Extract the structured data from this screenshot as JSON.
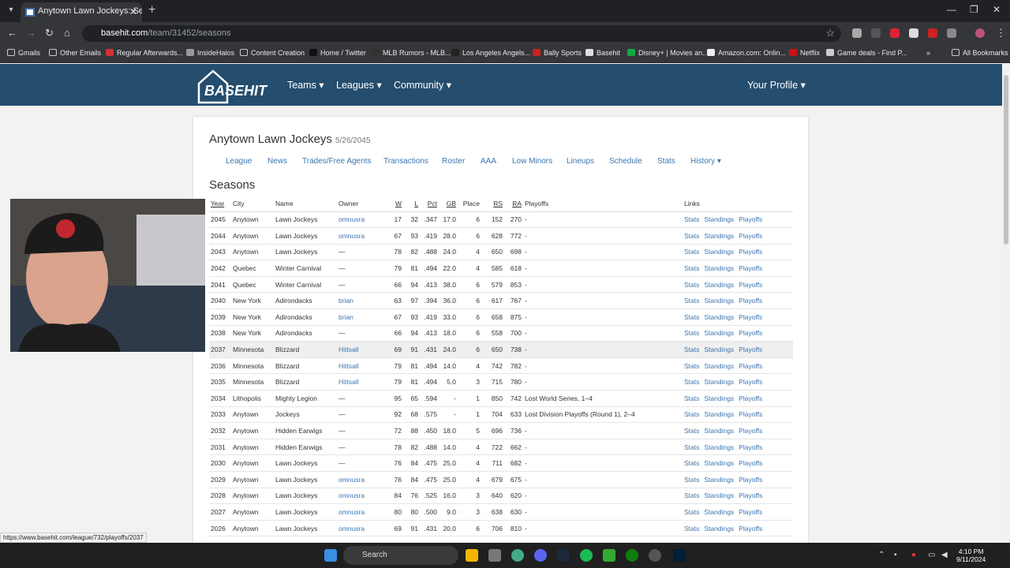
{
  "browser": {
    "tab_title": "Anytown Lawn Jockeys: Season",
    "url_domain": "basehit.com",
    "url_path": "/team/31452/seasons",
    "bookmarks": [
      "Gmails",
      "Other Emails",
      "Regular Afterwards...",
      "InsideHalos",
      "Content Creation",
      "Home / Twitter",
      "MLB Rumors - MLB...",
      "Los Angeles Angels...",
      "Bally Sports",
      "Basehit",
      "Disney+ | Movies an...",
      "Amazon.com: Onlin...",
      "Netflix",
      "Game deals - Find P..."
    ],
    "all_bookmarks": "All Bookmarks"
  },
  "site": {
    "logo": "BASEHIT",
    "nav": [
      "Teams",
      "Leagues",
      "Community"
    ],
    "profile": "Your Profile"
  },
  "page": {
    "team": "Anytown Lawn Jockeys",
    "date": "5/26/2045",
    "subnav": [
      "League",
      "News",
      "Trades/Free Agents",
      "Transactions",
      "Roster",
      "AAA",
      "Low Minors",
      "Lineups",
      "Schedule",
      "Stats",
      "History"
    ],
    "section": "Seasons",
    "headers": [
      "Year",
      "City",
      "Name",
      "Owner",
      "W",
      "L",
      "Pct",
      "GB",
      "Place",
      "RS",
      "RA",
      "Playoffs",
      "Links"
    ],
    "link_labels": [
      "Stats",
      "Standings",
      "Playoffs"
    ],
    "rows": [
      [
        "2045",
        "Anytown",
        "Lawn Jockeys",
        "omnusra",
        "17",
        "32",
        ".347",
        "17.0",
        "6",
        "152",
        "270",
        "-"
      ],
      [
        "2044",
        "Anytown",
        "Lawn Jockeys",
        "omnusra",
        "67",
        "93",
        ".419",
        "28.0",
        "6",
        "628",
        "772",
        "-"
      ],
      [
        "2043",
        "Anytown",
        "Lawn Jockeys",
        "—",
        "78",
        "82",
        ".488",
        "24.0",
        "4",
        "650",
        "698",
        "-"
      ],
      [
        "2042",
        "Quebec",
        "Winter Carnival",
        "—",
        "79",
        "81",
        ".494",
        "22.0",
        "4",
        "585",
        "618",
        "-"
      ],
      [
        "2041",
        "Quebec",
        "Winter Carnival",
        "—",
        "66",
        "94",
        ".413",
        "38.0",
        "6",
        "579",
        "853",
        "-"
      ],
      [
        "2040",
        "New York",
        "Adirondacks",
        "brian",
        "63",
        "97",
        ".394",
        "36.0",
        "6",
        "617",
        "767",
        "-"
      ],
      [
        "2039",
        "New York",
        "Adirondacks",
        "brian",
        "67",
        "93",
        ".419",
        "33.0",
        "6",
        "658",
        "875",
        "-"
      ],
      [
        "2038",
        "New York",
        "Adirondacks",
        "—",
        "66",
        "94",
        ".413",
        "18.0",
        "6",
        "558",
        "700",
        "-"
      ],
      [
        "2037",
        "Minnesota",
        "Blizzard",
        "Hittsall",
        "69",
        "91",
        ".431",
        "24.0",
        "6",
        "650",
        "738",
        "-"
      ],
      [
        "2036",
        "Minnesota",
        "Blizzard",
        "Hittsall",
        "79",
        "81",
        ".494",
        "14.0",
        "4",
        "742",
        "782",
        "-"
      ],
      [
        "2035",
        "Minnesota",
        "Blizzard",
        "Hittsall",
        "79",
        "81",
        ".494",
        "5.0",
        "3",
        "715",
        "780",
        "-"
      ],
      [
        "2034",
        "Lithopolis",
        "Mighty Legion",
        "—",
        "95",
        "65",
        ".594",
        "-",
        "1",
        "850",
        "742",
        "Lost World Series, 1–4"
      ],
      [
        "2033",
        "Anytown",
        "Jockeys",
        "—",
        "92",
        "68",
        ".575",
        "-",
        "1",
        "704",
        "633",
        "Lost Division Playoffs (Round 1), 2–4"
      ],
      [
        "2032",
        "Anytown",
        "Hidden Earwigs",
        "—",
        "72",
        "88",
        ".450",
        "18.0",
        "5",
        "696",
        "736",
        "-"
      ],
      [
        "2031",
        "Anytown",
        "Hidden Earwigs",
        "—",
        "78",
        "82",
        ".488",
        "14.0",
        "4",
        "722",
        "662",
        "-"
      ],
      [
        "2030",
        "Anytown",
        "Lawn Jockeys",
        "—",
        "76",
        "84",
        ".475",
        "25.0",
        "4",
        "711",
        "682",
        "-"
      ],
      [
        "2029",
        "Anytown",
        "Lawn Jockeys",
        "omnusra",
        "76",
        "84",
        ".475",
        "25.0",
        "4",
        "679",
        "675",
        "-"
      ],
      [
        "2028",
        "Anytown",
        "Lawn Jockeys",
        "omnusra",
        "84",
        "76",
        ".525",
        "16.0",
        "3",
        "640",
        "620",
        "-"
      ],
      [
        "2027",
        "Anytown",
        "Lawn Jockeys",
        "omnusra",
        "80",
        "80",
        ".500",
        "9.0",
        "3",
        "638",
        "630",
        "-"
      ],
      [
        "2026",
        "Anytown",
        "Lawn Jockeys",
        "omnusra",
        "69",
        "91",
        ".431",
        "20.0",
        "6",
        "706",
        "810",
        "-"
      ]
    ]
  },
  "status_url": "https://www.basehit.com/league/732/playoffs/2037",
  "taskbar": {
    "search": "Search",
    "time": "4:10 PM",
    "date": "9/11/2024"
  }
}
